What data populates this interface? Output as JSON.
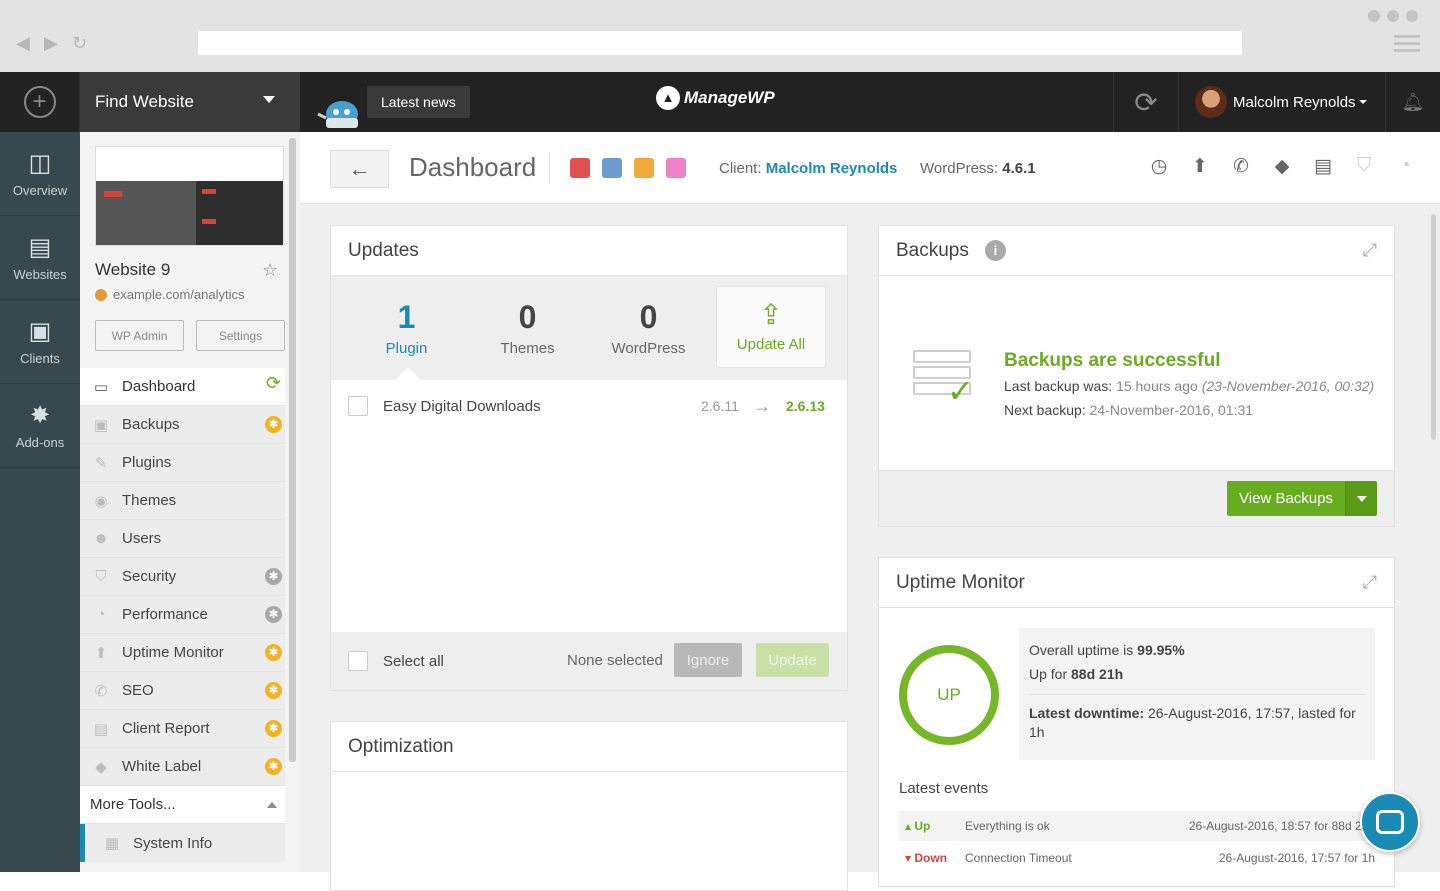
{
  "browser": {
    "back": "◀",
    "forward": "▶",
    "reload": "↻"
  },
  "topbar": {
    "find_website": "Find Website",
    "latest_news": "Latest news",
    "logo": "ManageWP",
    "user_name": "Malcolm Reynolds"
  },
  "leftnav": [
    {
      "label": "Overview",
      "icon": "overview-icon"
    },
    {
      "label": "Websites",
      "icon": "websites-icon"
    },
    {
      "label": "Clients",
      "icon": "clients-icon"
    },
    {
      "label": "Add-ons",
      "icon": "addons-icon"
    }
  ],
  "site": {
    "name": "Website 9",
    "url": "example.com/analytics",
    "wp_admin": "WP Admin",
    "settings": "Settings"
  },
  "menu": [
    {
      "label": "Dashboard",
      "icon": "▭",
      "badge": "sync"
    },
    {
      "label": "Backups",
      "icon": "▣",
      "badge": "gold"
    },
    {
      "label": "Plugins",
      "icon": "✎",
      "badge": ""
    },
    {
      "label": "Themes",
      "icon": "◉",
      "badge": ""
    },
    {
      "label": "Users",
      "icon": "☻",
      "badge": ""
    },
    {
      "label": "Security",
      "icon": "⛉",
      "badge": "grey"
    },
    {
      "label": "Performance",
      "icon": "◔",
      "badge": "grey"
    },
    {
      "label": "Uptime Monitor",
      "icon": "⬆",
      "badge": "gold"
    },
    {
      "label": "SEO",
      "icon": "✆",
      "badge": "gold"
    },
    {
      "label": "Client Report",
      "icon": "▤",
      "badge": "gold"
    },
    {
      "label": "White Label",
      "icon": "◆",
      "badge": "gold"
    }
  ],
  "more_tools": "More Tools...",
  "system_info": "System Info",
  "header": {
    "back": "←",
    "title": "Dashboard",
    "tag_colors": [
      "#e05252",
      "#6b9bd2",
      "#f2a93b",
      "#ee82c8"
    ],
    "client_label": "Client:",
    "client_name": "Malcolm Reynolds",
    "wp_label": "WordPress:",
    "wp_version": "4.6.1"
  },
  "updates": {
    "title": "Updates",
    "stats": [
      {
        "num": "1",
        "label": "Plugin"
      },
      {
        "num": "0",
        "label": "Themes"
      },
      {
        "num": "0",
        "label": "WordPress"
      }
    ],
    "update_all": "Update All",
    "rows": [
      {
        "name": "Easy Digital Downloads",
        "from": "2.6.11",
        "to": "2.6.13"
      }
    ],
    "select_all": "Select all",
    "none_selected": "None selected",
    "ignore": "Ignore",
    "update": "Update"
  },
  "optimization": {
    "title": "Optimization"
  },
  "backups": {
    "title": "Backups",
    "status": "Backups are successful",
    "last_label": "Last backup was:",
    "last_value": "15 hours ago",
    "last_date": "(23-November-2016, 00:32)",
    "next_label": "Next backup:",
    "next_value": "24-November-2016, 01:31",
    "view_button": "View Backups"
  },
  "uptime": {
    "title": "Uptime Monitor",
    "ring": "UP",
    "overall_label": "Overall uptime is",
    "overall_value": "99.95%",
    "upfor_label": "Up for",
    "upfor_value": "88d 21h",
    "downtime_label": "Latest downtime:",
    "downtime_value": "26-August-2016, 17:57, lasted for 1h",
    "latest_events": "Latest events",
    "events": [
      {
        "status": "▴ Up",
        "message": "Everything is ok",
        "when": "26-August-2016, 18:57 for 88d 21h"
      },
      {
        "status": "▾ Down",
        "message": "Connection Timeout",
        "when": "26-August-2016, 17:57 for 1h"
      }
    ]
  }
}
